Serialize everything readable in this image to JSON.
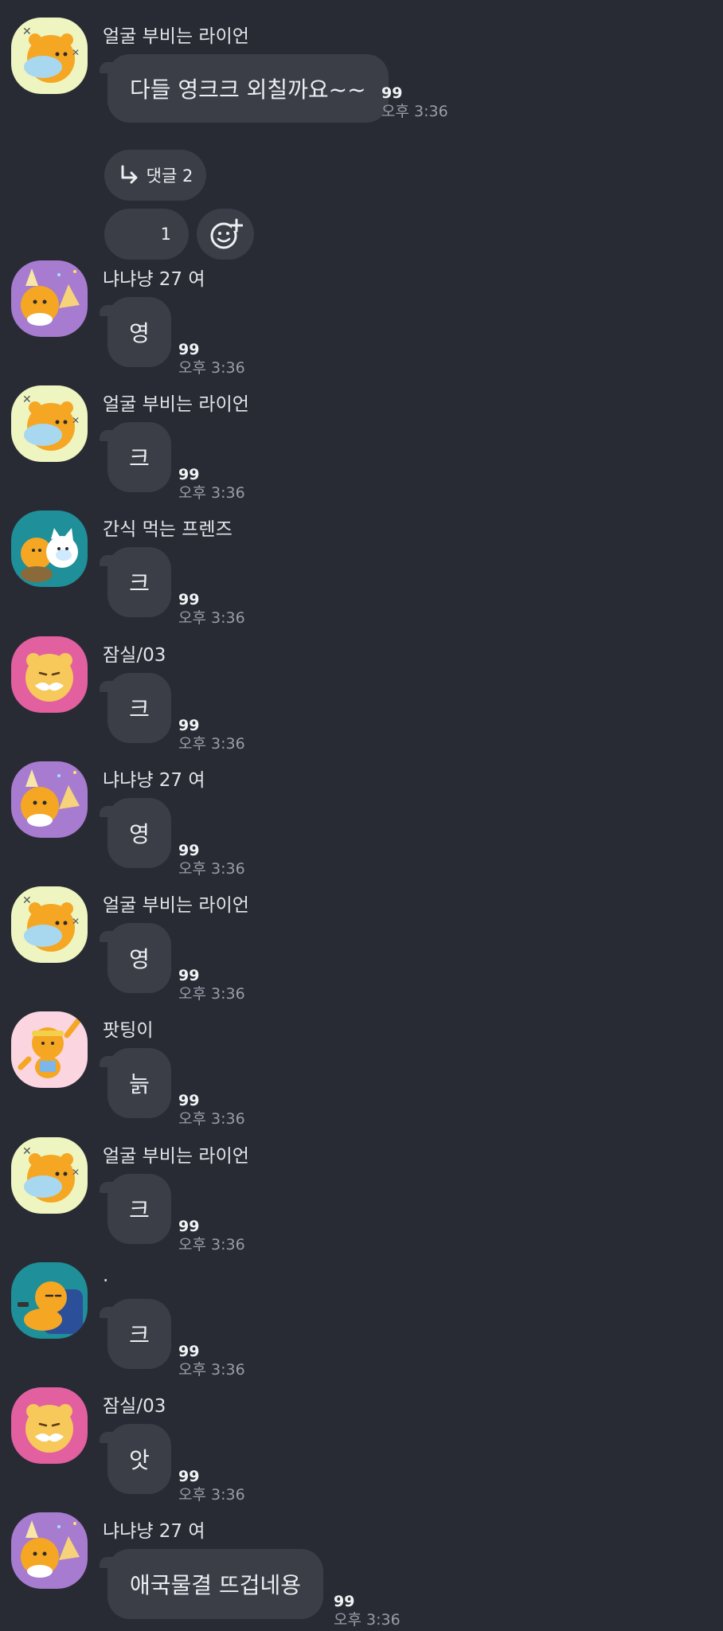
{
  "messages": [
    {
      "sender": "얼굴 부비는 라이언",
      "text": "다들 영크크 외칠까요~~",
      "unread": "99",
      "time": "오후 3:36",
      "avatar": "lion-hug-icon"
    },
    {
      "sender": "냐냐냥 27 여",
      "text": "영",
      "unread": "99",
      "time": "오후 3:36",
      "avatar": "party-lion-icon"
    },
    {
      "sender": "얼굴 부비는 라이언",
      "text": "크",
      "unread": "99",
      "time": "오후 3:36",
      "avatar": "lion-hug-icon"
    },
    {
      "sender": "간식 먹는 프렌즈",
      "text": "크",
      "unread": "99",
      "time": "오후 3:36",
      "avatar": "snack-friends-icon"
    },
    {
      "sender": "잠실/03",
      "text": "크",
      "unread": "99",
      "time": "오후 3:36",
      "avatar": "lion-mustache-icon"
    },
    {
      "sender": "냐냐냥 27 여",
      "text": "영",
      "unread": "99",
      "time": "오후 3:36",
      "avatar": "party-lion-icon"
    },
    {
      "sender": "얼굴 부비는 라이언",
      "text": "영",
      "unread": "99",
      "time": "오후 3:36",
      "avatar": "lion-hug-icon"
    },
    {
      "sender": "팟팅이",
      "text": "늙",
      "unread": "99",
      "time": "오후 3:36",
      "avatar": "cheer-lion-icon"
    },
    {
      "sender": "얼굴 부비는 라이언",
      "text": "크",
      "unread": "99",
      "time": "오후 3:36",
      "avatar": "lion-hug-icon"
    },
    {
      "sender": ".",
      "text": "크",
      "unread": "99",
      "time": "오후 3:36",
      "avatar": "lion-sofa-icon"
    },
    {
      "sender": "잠실/03",
      "text": "앗",
      "unread": "99",
      "time": "오후 3:36",
      "avatar": "lion-mustache-icon"
    },
    {
      "sender": "냐냐냥 27 여",
      "text": "애국물결 뜨겁네용",
      "unread": "99",
      "time": "오후 3:36",
      "avatar": "party-lion-icon"
    }
  ],
  "replies": {
    "label": "댓글 2"
  },
  "reaction": {
    "count": "1"
  },
  "colors": {
    "background": "#282b34",
    "bubble": "#3b3e46",
    "lion": "#f5a623",
    "avatar_lime": "#eef5c0",
    "avatar_purple": "#a77bcf",
    "avatar_teal": "#1f8f99",
    "avatar_pink": "#e25fa0",
    "avatar_lightpink": "#fbd5e0"
  }
}
